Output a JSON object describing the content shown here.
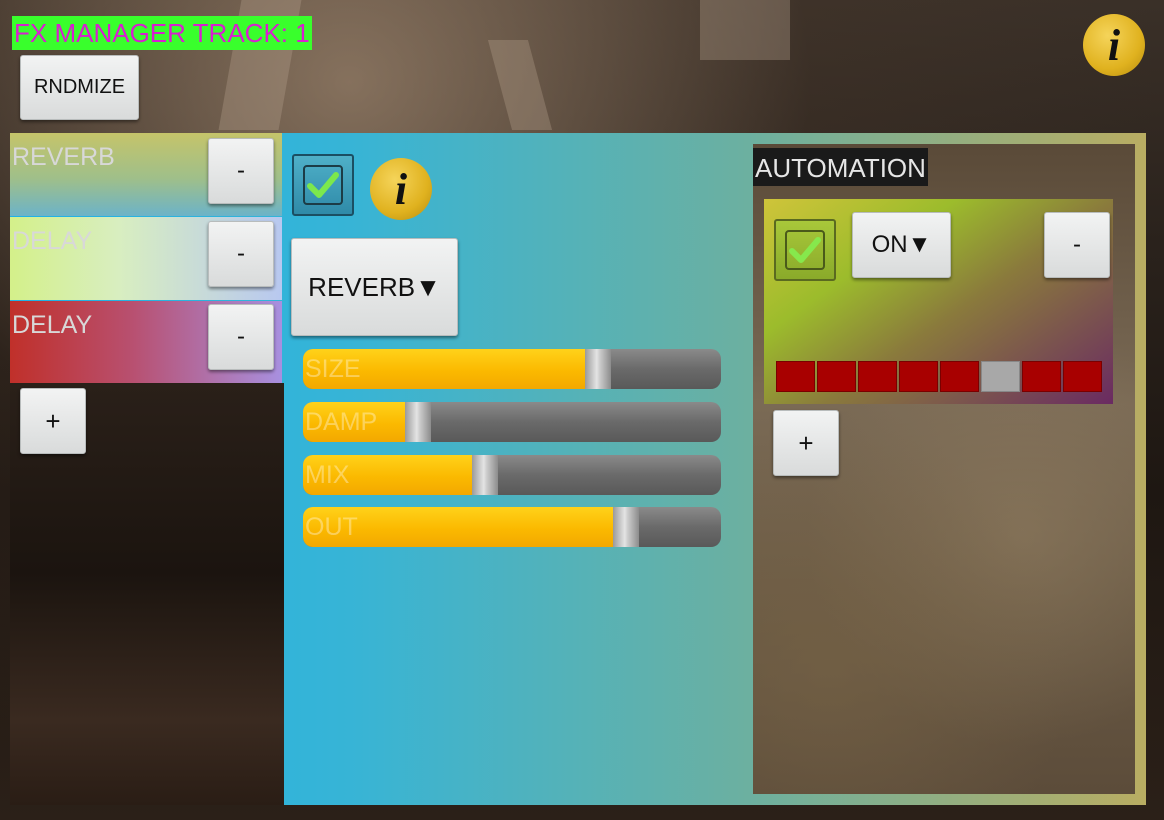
{
  "header": {
    "title": "FX MANAGER TRACK: 1",
    "randomize_label": "RNDMIZE",
    "info_icon": "i"
  },
  "fx_list": {
    "items": [
      {
        "label": "REVERB",
        "remove_label": "-"
      },
      {
        "label": "DELAY",
        "remove_label": "-"
      },
      {
        "label": "DELAY",
        "remove_label": "-"
      }
    ],
    "add_label": "+"
  },
  "editor": {
    "enabled": true,
    "info_icon": "i",
    "effect_select": "REVERB▼",
    "sliders": [
      {
        "label": "SIZE",
        "value": 0.72
      },
      {
        "label": "DAMP",
        "value": 0.26
      },
      {
        "label": "MIX",
        "value": 0.43
      },
      {
        "label": "OUT",
        "value": 0.79
      }
    ]
  },
  "automation": {
    "title": "AUTOMATION",
    "enabled": true,
    "mode_select": "ON▼",
    "remove_label": "-",
    "add_label": "+",
    "steps": [
      false,
      false,
      false,
      false,
      false,
      true,
      false,
      false
    ]
  },
  "colors": {
    "title_bg": "#39ff2c",
    "title_text": "#d81fd0",
    "slider_fill": "#fbb900",
    "step_off": "#a80000",
    "step_on": "#a8a8a8"
  }
}
